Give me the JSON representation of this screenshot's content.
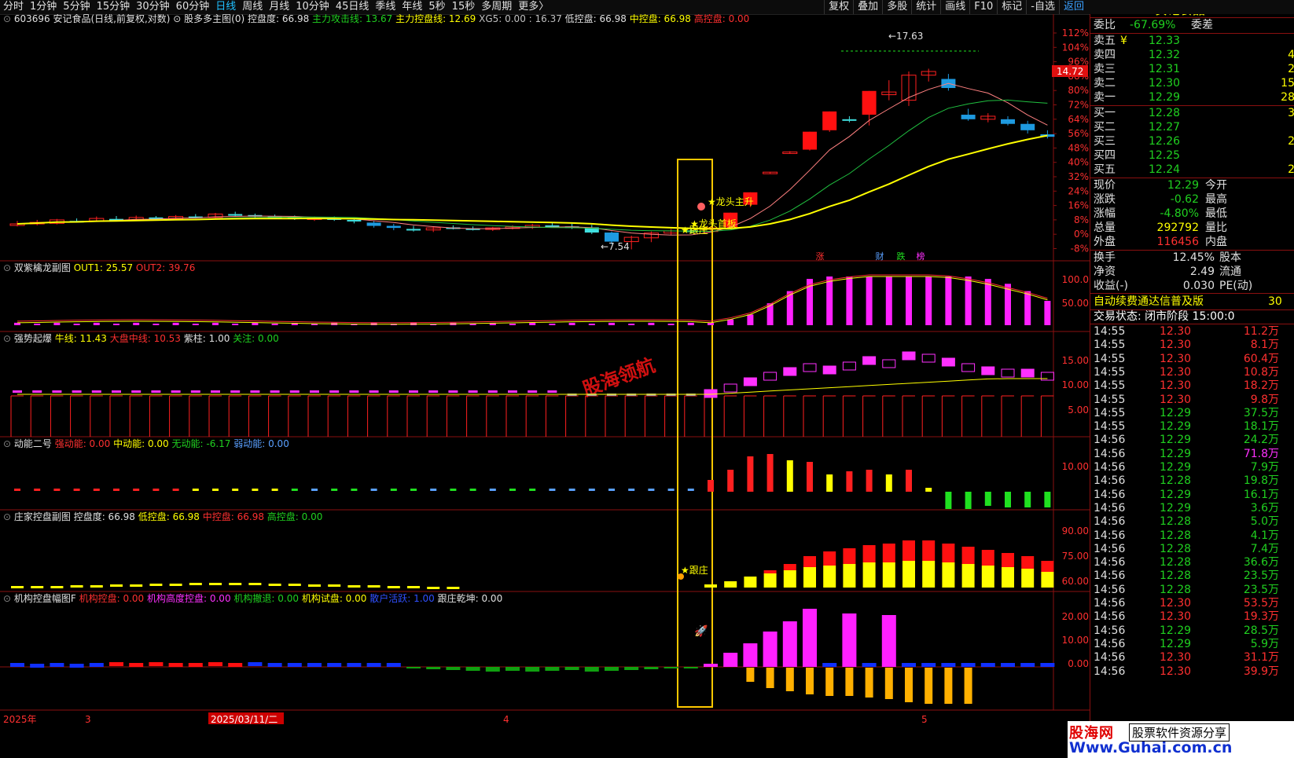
{
  "toolbar": {
    "periods": [
      "分时",
      "1分钟",
      "5分钟",
      "15分钟",
      "30分钟",
      "60分钟",
      "日线",
      "周线",
      "月线",
      "10分钟",
      "45日线",
      "季线",
      "年线",
      "5秒",
      "15秒",
      "多周期",
      "更多〉"
    ],
    "active_period": "日线",
    "tools": [
      "复权",
      "叠加",
      "多股",
      "统计",
      "画线",
      "F10",
      "标记",
      "-自选",
      "返回"
    ]
  },
  "main_panel": {
    "title": "603696 安记食品(日线,前复权,对数)",
    "indicator": "股多多主图(0)",
    "items": [
      {
        "label": "控盘度: 66.98",
        "color": "#e0e0e0"
      },
      {
        "label": "主力攻击线: 13.67",
        "color": "#20d020"
      },
      {
        "label": "主力控盘线: 12.69",
        "color": "#ffff00"
      },
      {
        "label": "XG5: 0.00 : 16.37",
        "color": "#c0c0c0"
      },
      {
        "label": "低控盘: 66.98",
        "color": "#e0e0e0"
      },
      {
        "label": "中控盘: 66.98",
        "color": "#ffff00"
      },
      {
        "label": "高控盘: 0.00",
        "color": "#ff3030"
      }
    ],
    "y_ticks": [
      "112%",
      "104%",
      "96%",
      "88%",
      "80%",
      "72%",
      "64%",
      "56%",
      "48%",
      "40%",
      "32%",
      "24%",
      "16%",
      "8%",
      "0%",
      "-8%"
    ],
    "price_tag": "14.72",
    "high_label": "17.63",
    "low_label": "7.54",
    "annotations": [
      "龙头主升",
      "龙头首板",
      "跟庄"
    ],
    "markers": [
      "涨",
      "财",
      "跌",
      "榜"
    ],
    "watermark_text": "股海领航"
  },
  "panel_shuangzi": {
    "title": "双紫檎龙副图",
    "items": [
      {
        "label": "OUT1: 25.57",
        "color": "#ffff00"
      },
      {
        "label": "OUT2: 39.76",
        "color": "#ff3030"
      }
    ],
    "y_ticks": [
      "100.0",
      "50.00"
    ]
  },
  "panel_qiangshi": {
    "title": "强势起爆",
    "items": [
      {
        "label": "牛线: 11.43",
        "color": "#ffff00"
      },
      {
        "label": "大盘中线: 10.53",
        "color": "#ff3030"
      },
      {
        "label": "紫柱: 1.00",
        "color": "#e0e0e0"
      },
      {
        "label": "关注: 0.00",
        "color": "#20d020"
      }
    ],
    "y_ticks": [
      "15.00",
      "10.00",
      "5.00"
    ]
  },
  "panel_dongneng": {
    "title": "动能二号",
    "items": [
      {
        "label": "强动能: 0.00",
        "color": "#ff3030"
      },
      {
        "label": "中动能: 0.00",
        "color": "#ffff00"
      },
      {
        "label": "无动能: -6.17",
        "color": "#20d020"
      },
      {
        "label": "弱动能: 0.00",
        "color": "#5aa0ff"
      }
    ],
    "y_ticks": [
      "10.00"
    ]
  },
  "panel_zhuangjia": {
    "title": "庄家控盘副图",
    "items": [
      {
        "label": "控盘度: 66.98",
        "color": "#e0e0e0"
      },
      {
        "label": "低控盘: 66.98",
        "color": "#ffff00"
      },
      {
        "label": "中控盘: 66.98",
        "color": "#ff3030"
      },
      {
        "label": "高控盘: 0.00",
        "color": "#20d020"
      }
    ],
    "y_ticks": [
      "90.00",
      "75.00",
      "60.00"
    ],
    "annotation": "跟庄"
  },
  "panel_jigou": {
    "title": "机构控盘幅图F",
    "items": [
      {
        "label": "机构控盘: 0.00",
        "color": "#ff3030"
      },
      {
        "label": "机构高度控盘: 0.00",
        "color": "#ff30ff"
      },
      {
        "label": "机构撤退: 0.00",
        "color": "#20d020"
      },
      {
        "label": "机构试盘: 0.00",
        "color": "#ffff00"
      },
      {
        "label": "散户活跃: 1.00",
        "color": "#3050ff"
      },
      {
        "label": "跟庄乾坤: 0.00",
        "color": "#e0e0e0"
      }
    ],
    "y_ticks": [
      "20.00",
      "10.00",
      "0.00"
    ]
  },
  "time_axis": [
    "2025年",
    "3",
    "2025/03/11/二",
    "4",
    "5"
  ],
  "chart_data": {
    "type": "candlestick",
    "series": [
      {
        "o": 8.5,
        "h": 8.62,
        "l": 8.4,
        "c": 8.5
      },
      {
        "o": 8.5,
        "h": 8.66,
        "l": 8.44,
        "c": 8.56
      },
      {
        "o": 8.52,
        "h": 8.7,
        "l": 8.48,
        "c": 8.66
      },
      {
        "o": 8.62,
        "h": 8.72,
        "l": 8.55,
        "c": 8.6
      },
      {
        "o": 8.62,
        "h": 8.8,
        "l": 8.58,
        "c": 8.72
      },
      {
        "o": 8.7,
        "h": 8.82,
        "l": 8.62,
        "c": 8.66
      },
      {
        "o": 8.66,
        "h": 8.84,
        "l": 8.62,
        "c": 8.76
      },
      {
        "o": 8.76,
        "h": 8.82,
        "l": 8.68,
        "c": 8.72
      },
      {
        "o": 8.7,
        "h": 8.86,
        "l": 8.66,
        "c": 8.8
      },
      {
        "o": 8.8,
        "h": 8.9,
        "l": 8.72,
        "c": 8.76
      },
      {
        "o": 8.76,
        "h": 8.95,
        "l": 8.72,
        "c": 8.9
      },
      {
        "o": 8.9,
        "h": 9.0,
        "l": 8.8,
        "c": 8.84
      },
      {
        "o": 8.86,
        "h": 8.92,
        "l": 8.76,
        "c": 8.8
      },
      {
        "o": 8.8,
        "h": 8.88,
        "l": 8.7,
        "c": 8.76
      },
      {
        "o": 8.76,
        "h": 8.84,
        "l": 8.66,
        "c": 8.72
      },
      {
        "o": 8.7,
        "h": 8.8,
        "l": 8.62,
        "c": 8.74
      },
      {
        "o": 8.74,
        "h": 8.8,
        "l": 8.62,
        "c": 8.66
      },
      {
        "o": 8.66,
        "h": 8.74,
        "l": 8.52,
        "c": 8.6
      },
      {
        "o": 8.55,
        "h": 8.62,
        "l": 8.35,
        "c": 8.42
      },
      {
        "o": 8.42,
        "h": 8.5,
        "l": 8.25,
        "c": 8.34
      },
      {
        "o": 8.3,
        "h": 8.42,
        "l": 8.2,
        "c": 8.26
      },
      {
        "o": 8.26,
        "h": 8.4,
        "l": 8.18,
        "c": 8.34
      },
      {
        "o": 8.36,
        "h": 8.44,
        "l": 8.28,
        "c": 8.32
      },
      {
        "o": 8.32,
        "h": 8.4,
        "l": 8.24,
        "c": 8.3
      },
      {
        "o": 8.3,
        "h": 8.38,
        "l": 8.22,
        "c": 8.34
      },
      {
        "o": 8.34,
        "h": 8.44,
        "l": 8.28,
        "c": 8.38
      },
      {
        "o": 8.38,
        "h": 8.5,
        "l": 8.3,
        "c": 8.44
      },
      {
        "o": 8.44,
        "h": 8.55,
        "l": 8.36,
        "c": 8.4
      },
      {
        "o": 8.4,
        "h": 8.5,
        "l": 8.3,
        "c": 8.36
      },
      {
        "o": 8.36,
        "h": 8.46,
        "l": 8.1,
        "c": 8.16
      },
      {
        "o": 8.16,
        "h": 8.2,
        "l": 7.72,
        "c": 7.82
      },
      {
        "o": 7.82,
        "h": 8.04,
        "l": 7.54,
        "c": 7.98
      },
      {
        "o": 7.96,
        "h": 8.2,
        "l": 7.8,
        "c": 8.14
      },
      {
        "o": 8.14,
        "h": 8.3,
        "l": 8.06,
        "c": 8.22
      },
      {
        "o": 8.24,
        "h": 8.36,
        "l": 8.12,
        "c": 8.2
      },
      {
        "o": 8.2,
        "h": 8.4,
        "l": 8.16,
        "c": 8.34
      },
      {
        "o": 8.36,
        "h": 8.96,
        "l": 8.3,
        "c": 8.96
      },
      {
        "o": 9.3,
        "h": 9.86,
        "l": 9.2,
        "c": 9.86
      },
      {
        "o": 10.8,
        "h": 10.85,
        "l": 10.75,
        "c": 10.84
      },
      {
        "o": 11.9,
        "h": 11.96,
        "l": 11.85,
        "c": 11.92
      },
      {
        "o": 12.05,
        "h": 13.11,
        "l": 12.0,
        "c": 13.11
      },
      {
        "o": 13.2,
        "h": 14.42,
        "l": 13.1,
        "c": 14.42
      },
      {
        "o": 13.9,
        "h": 14.1,
        "l": 13.7,
        "c": 13.8
      },
      {
        "o": 14.2,
        "h": 15.88,
        "l": 13.5,
        "c": 15.88
      },
      {
        "o": 15.6,
        "h": 16.7,
        "l": 15.2,
        "c": 15.8
      },
      {
        "o": 15.2,
        "h": 17.4,
        "l": 14.8,
        "c": 17.1
      },
      {
        "o": 17.1,
        "h": 17.63,
        "l": 16.6,
        "c": 17.4
      },
      {
        "o": 16.8,
        "h": 17.2,
        "l": 15.9,
        "c": 16.1
      },
      {
        "o": 14.2,
        "h": 14.6,
        "l": 13.8,
        "c": 13.9
      },
      {
        "o": 13.9,
        "h": 14.3,
        "l": 13.7,
        "c": 14.1
      },
      {
        "o": 13.9,
        "h": 14.1,
        "l": 13.5,
        "c": 13.6
      },
      {
        "o": 13.6,
        "h": 13.8,
        "l": 13.0,
        "c": 13.2
      },
      {
        "o": 12.95,
        "h": 13.2,
        "l": 12.7,
        "c": 12.8
      }
    ]
  },
  "quote": {
    "code": "603696",
    "name": "安记食品",
    "weibi_label": "委比",
    "weibi_value": "-67.69%",
    "weicha_label": "委差",
    "asks": [
      {
        "label": "卖五",
        "mark": "¥",
        "price": "12.33"
      },
      {
        "label": "卖四",
        "mark": "",
        "price": "12.32"
      },
      {
        "label": "卖三",
        "mark": "",
        "price": "12.31"
      },
      {
        "label": "卖二",
        "mark": "",
        "price": "12.30"
      },
      {
        "label": "卖一",
        "mark": "",
        "price": "12.29"
      }
    ],
    "bids": [
      {
        "label": "买一",
        "price": "12.28",
        "vol": "3"
      },
      {
        "label": "买二",
        "price": "12.27",
        "vol": ""
      },
      {
        "label": "买三",
        "price": "12.26",
        "vol": "2"
      },
      {
        "label": "买四",
        "price": "12.25",
        "vol": ""
      },
      {
        "label": "买五",
        "price": "12.24",
        "vol": "2"
      }
    ],
    "ask_vols": [
      "",
      "4",
      "2",
      "15",
      "28"
    ],
    "stats": [
      {
        "l1": "现价",
        "v1": "12.29",
        "c1": "#20d020",
        "l2": "今开"
      },
      {
        "l1": "涨跌",
        "v1": "-0.62",
        "c1": "#20d020",
        "l2": "最高"
      },
      {
        "l1": "涨幅",
        "v1": "-4.80%",
        "c1": "#20d020",
        "l2": "最低"
      },
      {
        "l1": "总量",
        "v1": "292792",
        "c1": "#ffff00",
        "l2": "量比"
      },
      {
        "l1": "外盘",
        "v1": "116456",
        "c1": "#ff3030",
        "l2": "内盘"
      }
    ],
    "stats2": [
      {
        "l1": "换手",
        "v1": "12.45%",
        "l2": "股本"
      },
      {
        "l1": "净资",
        "v1": "2.49",
        "l2": "流通"
      },
      {
        "l1": "收益(-)",
        "v1": "0.030",
        "l2": "PE(动)"
      }
    ],
    "promo": "自动续费通达信普及版",
    "promo_num": "30",
    "trade_state": "交易状态: 闭市阶段 15:00:0",
    "ticks": [
      [
        "14:55",
        "12.30",
        "11.2万"
      ],
      [
        "14:55",
        "12.30",
        "8.1万"
      ],
      [
        "14:55",
        "12.30",
        "60.4万"
      ],
      [
        "14:55",
        "12.30",
        "10.8万"
      ],
      [
        "14:55",
        "12.30",
        "18.2万"
      ],
      [
        "14:55",
        "12.30",
        "9.8万"
      ],
      [
        "14:55",
        "12.29",
        "37.5万"
      ],
      [
        "14:55",
        "12.29",
        "18.1万"
      ],
      [
        "14:56",
        "12.29",
        "24.2万"
      ],
      [
        "14:56",
        "12.29",
        "71.8万"
      ],
      [
        "14:56",
        "12.29",
        "7.9万"
      ],
      [
        "14:56",
        "12.28",
        "19.8万"
      ],
      [
        "14:56",
        "12.29",
        "16.1万"
      ],
      [
        "14:56",
        "12.29",
        "3.6万"
      ],
      [
        "14:56",
        "12.28",
        "5.0万"
      ],
      [
        "14:56",
        "12.28",
        "4.1万"
      ],
      [
        "14:56",
        "12.28",
        "7.4万"
      ],
      [
        "14:56",
        "12.28",
        "36.6万"
      ],
      [
        "14:56",
        "12.28",
        "23.5万"
      ],
      [
        "14:56",
        "12.28",
        "23.5万"
      ],
      [
        "14:56",
        "12.30",
        "53.5万"
      ],
      [
        "14:56",
        "12.30",
        "19.3万"
      ],
      [
        "14:56",
        "12.29",
        "28.5万"
      ],
      [
        "14:56",
        "12.29",
        "5.9万"
      ],
      [
        "14:56",
        "12.30",
        "31.1万"
      ],
      [
        "14:56",
        "12.30",
        "39.9万"
      ]
    ]
  },
  "watermark": {
    "site": "股海网",
    "tag": "股票软件资源分享",
    "url": "Www.Guhai.com.cn"
  }
}
